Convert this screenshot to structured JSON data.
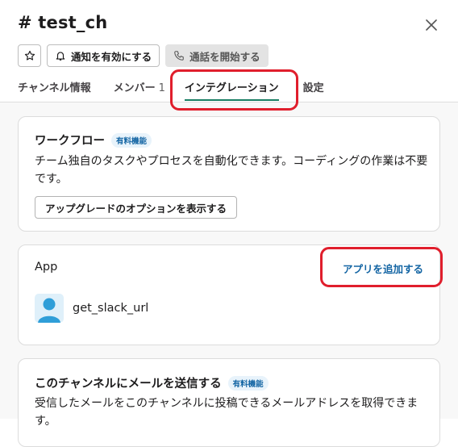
{
  "header": {
    "channel_title": "# test_ch",
    "close_icon": "close-icon",
    "buttons": {
      "star_icon": "star-icon",
      "notify_label": "通知を有効にする",
      "notify_icon": "bell-icon",
      "call_label": "通話を開始する",
      "call_icon": "phone-icon"
    }
  },
  "tabs": [
    {
      "label": "チャンネル情報"
    },
    {
      "label": "メンバー",
      "count": "1"
    },
    {
      "label": "インテグレーション",
      "active": true
    },
    {
      "label": "設定"
    }
  ],
  "workflow_card": {
    "title": "ワークフロー",
    "badge": "有料機能",
    "description": "チーム独自のタスクやプロセスを自動化できます。コーディングの作業は不要です。",
    "button_label": "アップグレードのオプションを表示する"
  },
  "app_card": {
    "label": "App",
    "add_link": "アプリを追加する",
    "apps": [
      {
        "name": "get_slack_url",
        "icon": "user-avatar-icon"
      }
    ]
  },
  "email_card": {
    "title": "このチャンネルにメールを送信する",
    "badge": "有料機能",
    "description": "受信したメールをこのチャンネルに投稿できるメールアドレスを取得できます。"
  },
  "colors": {
    "accent_underline": "#1a7f64",
    "link": "#1264a3",
    "annotation_red": "#e01e2c",
    "badge_bg": "#e8f3fb"
  }
}
